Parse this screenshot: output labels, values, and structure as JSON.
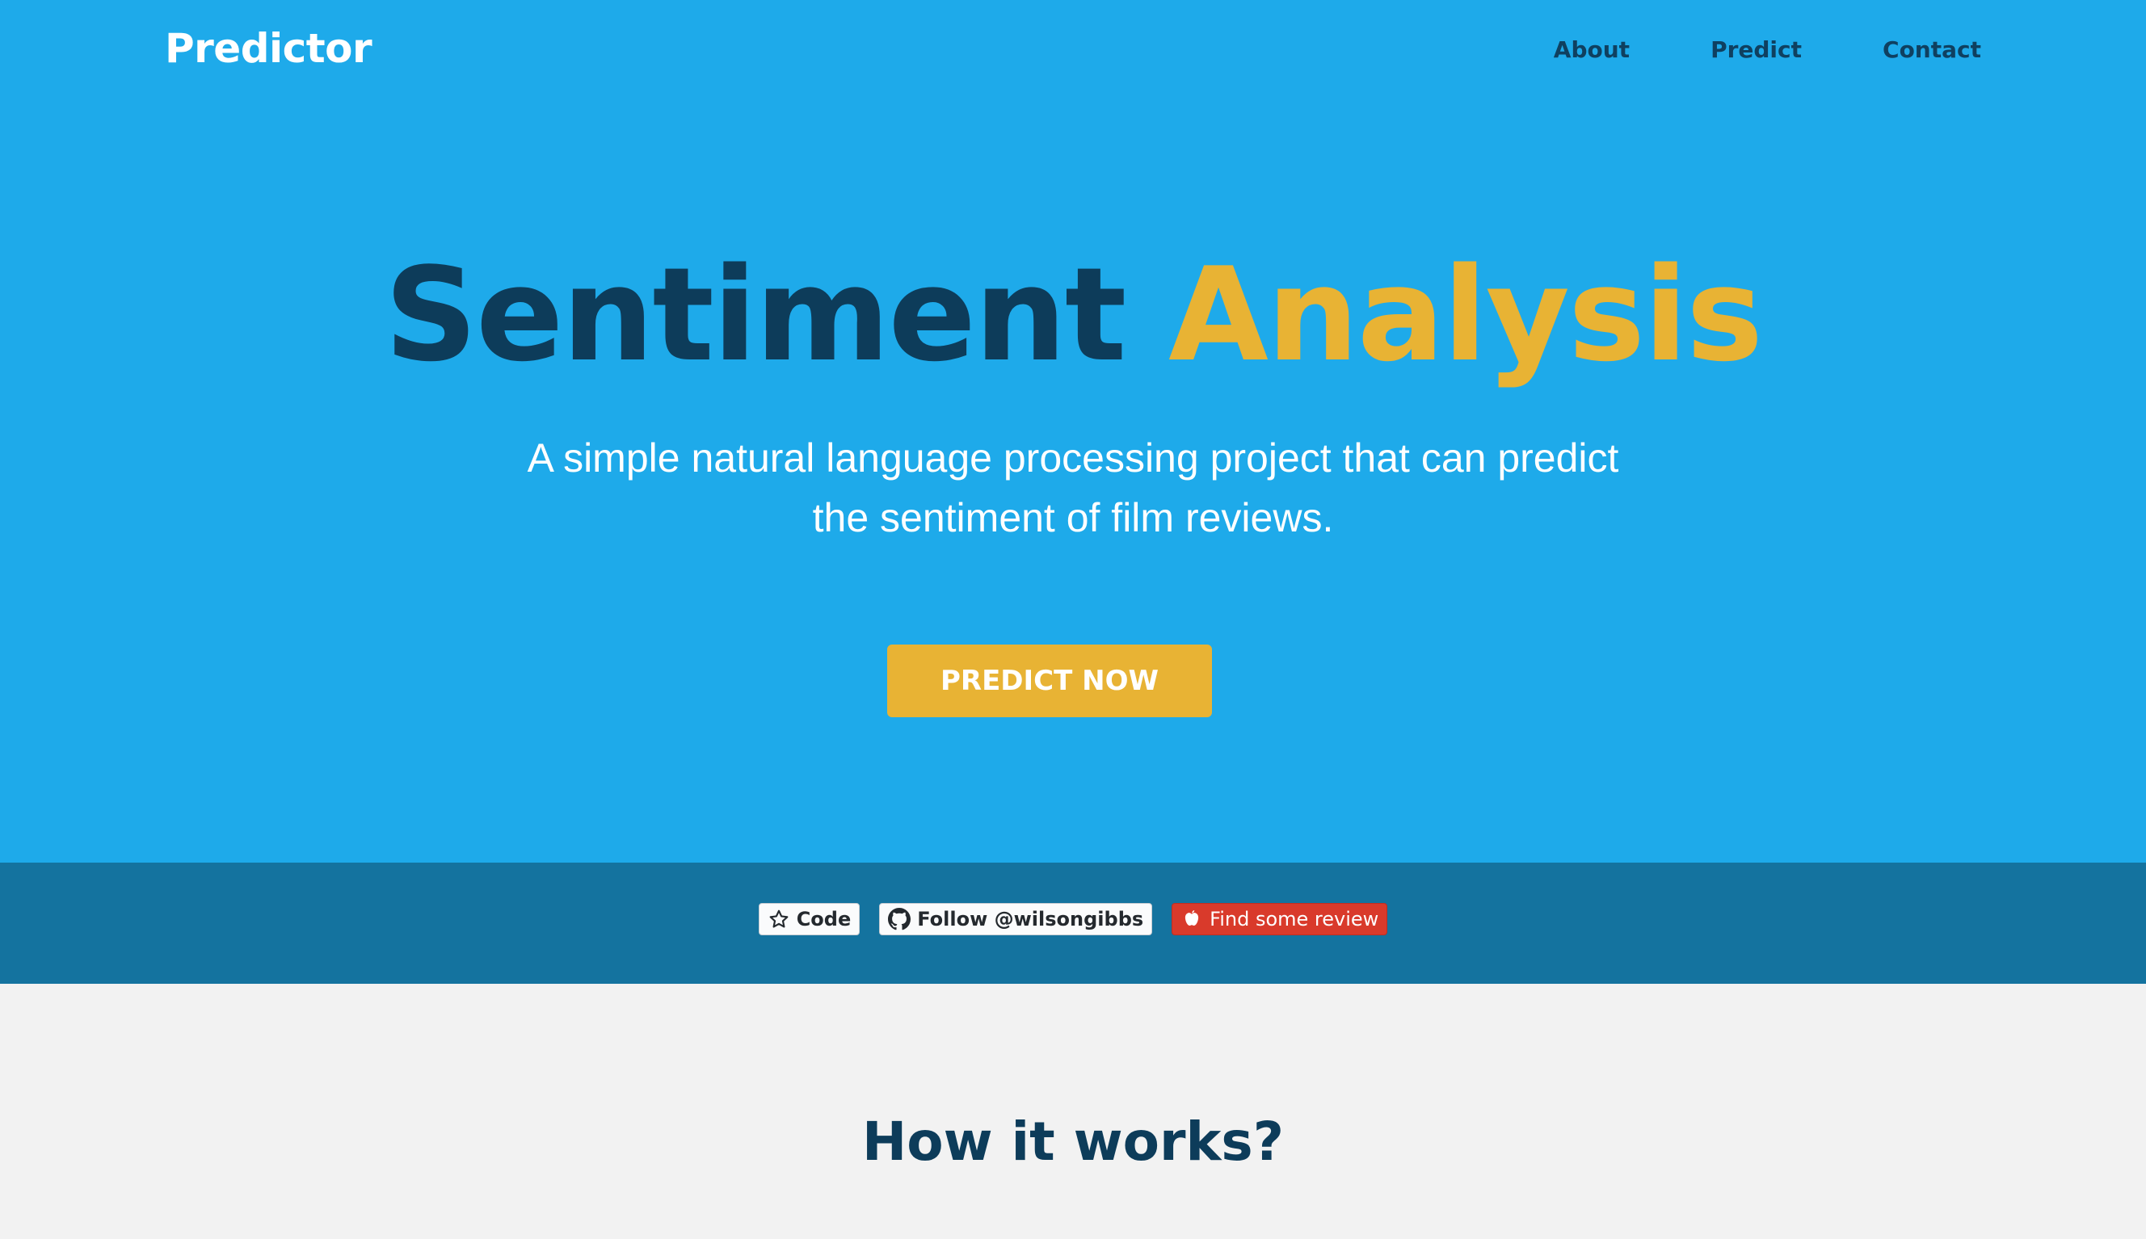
{
  "nav": {
    "brand": "Predictor",
    "links": [
      "About",
      "Predict",
      "Contact"
    ]
  },
  "hero": {
    "title_part1": "Sentiment",
    "title_part2": "Analysis",
    "subtitle_line1": "A simple natural language processing project that can predict",
    "subtitle_line2": "the sentiment of film reviews.",
    "cta_label": "PREDICT NOW"
  },
  "badges": [
    {
      "label": "Code",
      "icon": "star-icon"
    },
    {
      "label": "Follow @wilsongibbs",
      "icon": "github-icon"
    },
    {
      "label": "Find some review",
      "icon": "apple-icon"
    }
  ],
  "how": {
    "title": "How it works?"
  },
  "colors": {
    "hero_bg": "#1eaaea",
    "accent": "#e8b334",
    "dark": "#0d3c5a",
    "badge_bar": "#14739f",
    "section_bg": "#f2f2f2",
    "badge_red": "#d93a2b"
  }
}
